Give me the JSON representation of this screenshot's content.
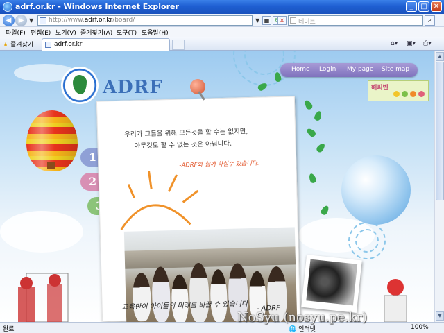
{
  "window": {
    "title": "adrf.or.kr - Windows Internet Explorer"
  },
  "address": {
    "url_prefix": "http://www.",
    "url_domain": "adrf.or.kr",
    "url_path": "/board/",
    "search_placeholder": "네이트"
  },
  "menu": [
    "파일(F)",
    "편집(E)",
    "보기(V)",
    "즐겨찾기(A)",
    "도구(T)",
    "도움말(H)"
  ],
  "tabs": {
    "favorites_label": "즐겨찾기",
    "active_tab": "adrf.or.kr"
  },
  "site": {
    "logo_text": "ADRF",
    "nav": [
      "Home",
      "Login",
      "My page",
      "Site map"
    ],
    "badge": "해피빈",
    "book_tabs": [
      "1",
      "2",
      "3"
    ],
    "message_line1": "우리가 그들을 위해 모든것을 할 수는 없지만,",
    "message_line2": "아무것도 할 수 없는 것은 아닙니다.",
    "signature1": "-ADRF와 함께 하실수 있습니다.",
    "bottom_text": "교육만이 아이들의 미래를 바꿀 수 있습니다",
    "signature2": "- ADRF"
  },
  "status": {
    "left": "완료",
    "zone": "인터넷",
    "zoom": "100%"
  },
  "watermark": "NoSyu (nosyu.pe.kr)"
}
